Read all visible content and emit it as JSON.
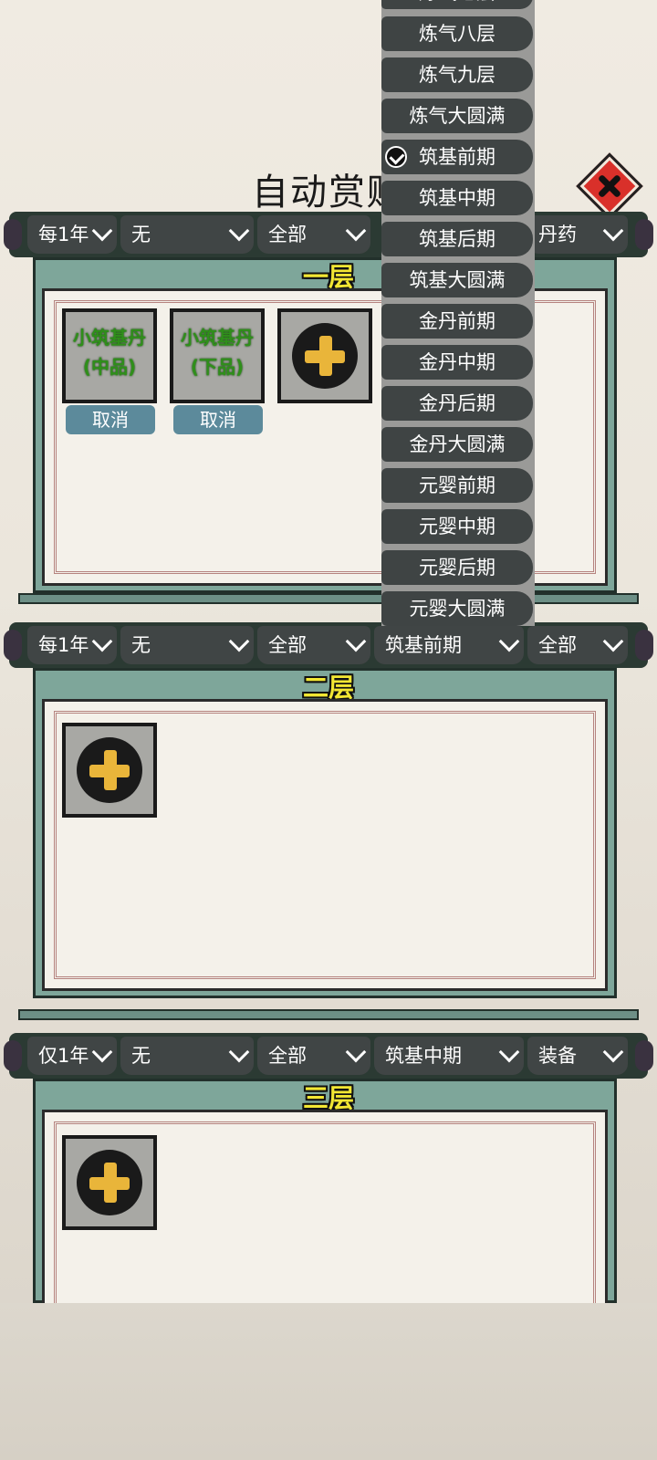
{
  "title": "自动赏赐",
  "tiers": [
    {
      "label": "一层",
      "filters": [
        "每1年",
        "无",
        "全部",
        "",
        "丹药"
      ],
      "items": [
        {
          "name_line1": "小筑基丹",
          "name_line2": "(中品)",
          "cancel": "取消"
        },
        {
          "name_line1": "小筑基丹",
          "name_line2": "(下品)",
          "cancel": "取消"
        }
      ]
    },
    {
      "label": "二层",
      "filters": [
        "每1年",
        "无",
        "全部",
        "筑基前期",
        "全部"
      ]
    },
    {
      "label": "三层",
      "filters": [
        "仅1年",
        "无",
        "全部",
        "筑基中期",
        "装备"
      ]
    }
  ],
  "dropdown": {
    "partial_item": "炼气七层",
    "items": [
      "炼气八层",
      "炼气九层",
      "炼气大圆满",
      "筑基前期",
      "筑基中期",
      "筑基后期",
      "筑基大圆满",
      "金丹前期",
      "金丹中期",
      "金丹后期",
      "金丹大圆满",
      "元婴前期",
      "元婴中期",
      "元婴后期",
      "元婴大圆满"
    ],
    "selected": "筑基前期"
  },
  "icons": {
    "close": "close-icon",
    "add": "plus-icon",
    "check": "check-icon"
  }
}
